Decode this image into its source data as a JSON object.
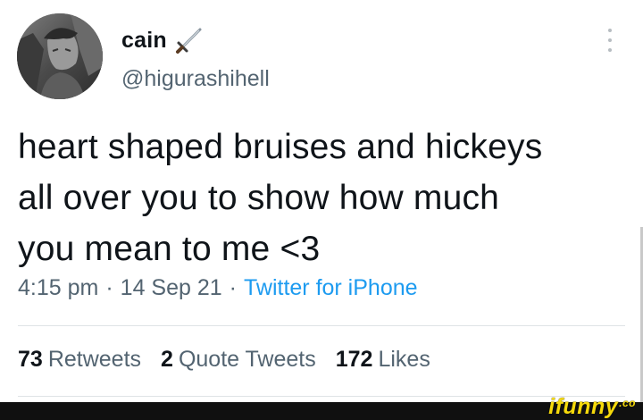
{
  "tweet": {
    "display_name": "cain",
    "handle": "@higurashihell",
    "text": "heart shaped bruises and hickeys\nall over you to show how much\nyou mean to me <3",
    "time": "4:15 pm",
    "date": "14 Sep 21",
    "separator": "·",
    "source": "Twitter for iPhone",
    "stats": {
      "retweets_count": "73",
      "retweets_label": "Retweets",
      "quotes_count": "2",
      "quotes_label": "Quote Tweets",
      "likes_count": "172",
      "likes_label": "Likes"
    }
  },
  "icons": {
    "name_emoji": "dagger-icon",
    "overflow": "more-vertical-icon"
  },
  "watermark": {
    "logo_text": "ifunny",
    "logo_suffix": ".co"
  },
  "colors": {
    "text_primary": "#0f1419",
    "text_secondary": "#536471",
    "link": "#1d9bf0",
    "divider": "#dfe3e6",
    "watermark_bg": "#101010",
    "watermark_fg": "#f5d90b"
  }
}
